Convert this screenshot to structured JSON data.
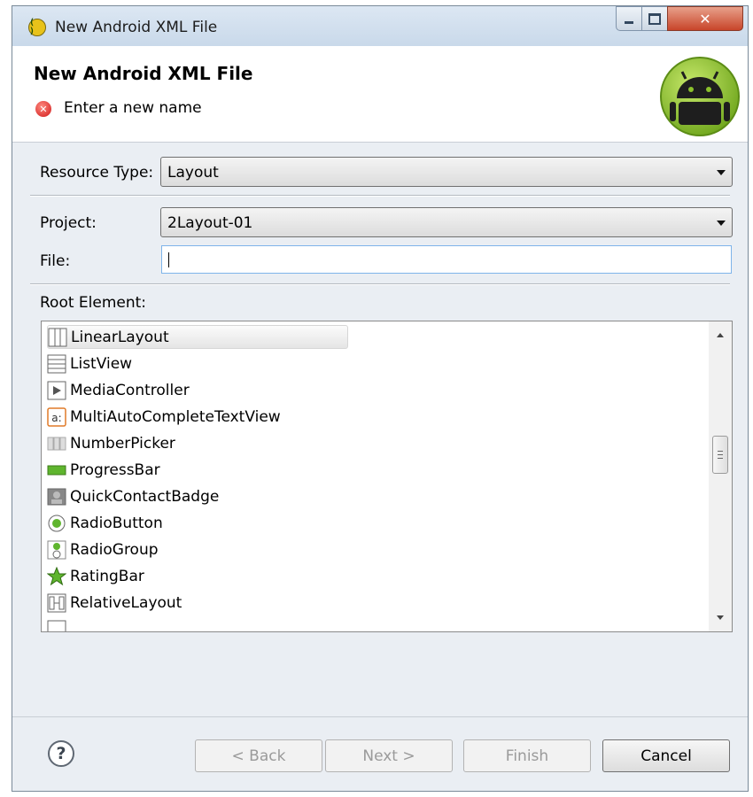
{
  "window": {
    "title": "New Android XML File",
    "icon": "android-app-icon"
  },
  "banner": {
    "title": "New Android XML File",
    "message": "Enter a new name",
    "message_icon": "error-icon",
    "logo": "android-logo"
  },
  "form": {
    "resource_type_label": "Resource Type:",
    "resource_type_value": "Layout",
    "project_label": "Project:",
    "project_value": "2Layout-01",
    "file_label": "File:",
    "file_value": "",
    "root_element_label": "Root Element:"
  },
  "root_elements": [
    {
      "label": "LinearLayout",
      "icon": "linearlayout-icon",
      "selected": true
    },
    {
      "label": "ListView",
      "icon": "listview-icon"
    },
    {
      "label": "MediaController",
      "icon": "mediacontroller-icon"
    },
    {
      "label": "MultiAutoCompleteTextView",
      "icon": "multiautocomplete-icon"
    },
    {
      "label": "NumberPicker",
      "icon": "numberpicker-icon"
    },
    {
      "label": "ProgressBar",
      "icon": "progressbar-icon"
    },
    {
      "label": "QuickContactBadge",
      "icon": "quickcontactbadge-icon"
    },
    {
      "label": "RadioButton",
      "icon": "radiobutton-icon"
    },
    {
      "label": "RadioGroup",
      "icon": "radiogroup-icon"
    },
    {
      "label": "RatingBar",
      "icon": "ratingbar-icon"
    },
    {
      "label": "RelativeLayout",
      "icon": "relativelayout-icon"
    }
  ],
  "buttons": {
    "back": "< Back",
    "next": "Next >",
    "finish": "Finish",
    "cancel": "Cancel"
  },
  "colors": {
    "android_green": "#8bc12c",
    "error_red": "#d01818",
    "focus_blue": "#7eb4ea"
  }
}
